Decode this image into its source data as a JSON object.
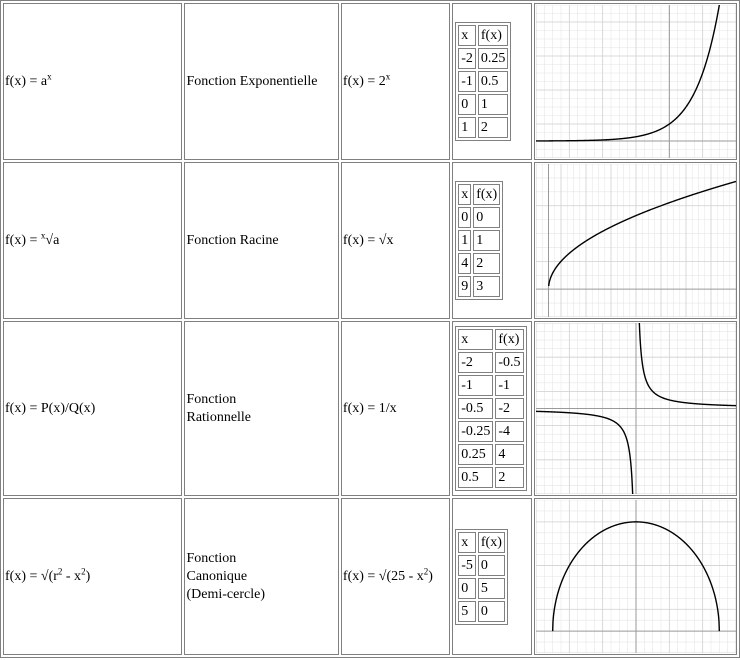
{
  "headings": {
    "row0_formula": "f(x) = a",
    "row0_formula_sup": "x",
    "row1_formula_pre": "f(x) = ",
    "row1_formula_sup": "x",
    "row1_formula_post": "√a",
    "row2_formula": "f(x) = P(x)/Q(x)",
    "row3_formula_pre": "f(x) = √(r",
    "row3_formula_sup1": "2",
    "row3_formula_mid": " - x",
    "row3_formula_sup2": "2",
    "row3_formula_post": ")"
  },
  "rows": [
    {
      "name": "Fonction Exponentielle",
      "example_pre": "f(x) = 2",
      "example_sup": "x",
      "table_header": [
        "x",
        "f(x)"
      ],
      "table_rows": [
        [
          "-2",
          "0.25"
        ],
        [
          "-1",
          "0.5"
        ],
        [
          "0",
          "1"
        ],
        [
          "1",
          "2"
        ]
      ]
    },
    {
      "name": "Fonction Racine",
      "example_pre": "f(x) = √x",
      "table_header": [
        "x",
        "f(x)"
      ],
      "table_rows": [
        [
          "0",
          "0"
        ],
        [
          "1",
          "1"
        ],
        [
          "4",
          "2"
        ],
        [
          "9",
          "3"
        ]
      ]
    },
    {
      "name_line1": "Fonction",
      "name_line2": "Rationnelle",
      "example_pre": "f(x) = 1/x",
      "table_header": [
        "x",
        "f(x)"
      ],
      "table_rows": [
        [
          "-2",
          "-0.5"
        ],
        [
          "-1",
          "-1"
        ],
        [
          "-0.5",
          "-2"
        ],
        [
          "-0.25",
          "-4"
        ],
        [
          "0.25",
          "4"
        ],
        [
          "0.5",
          "2"
        ]
      ]
    },
    {
      "name_line1": "Fonction",
      "name_line2": "Canonique",
      "name_line3": "(Demi-cercle)",
      "example_pre": "f(x) = √(25 - x",
      "example_sup": "2",
      "example_post": ")",
      "table_header": [
        "x",
        "f(x)"
      ],
      "table_rows": [
        [
          "-5",
          "0"
        ],
        [
          "0",
          "5"
        ],
        [
          "5",
          "0"
        ]
      ]
    }
  ],
  "chart_data": [
    {
      "type": "line",
      "function": "2^x",
      "xlim": [
        -8,
        4
      ],
      "ylim": [
        -1,
        8
      ],
      "grid": true,
      "title": "",
      "xlabel": "",
      "ylabel": ""
    },
    {
      "type": "line",
      "function": "sqrt(x)",
      "xlim": [
        -1,
        15
      ],
      "ylim": [
        -1,
        4.5
      ],
      "grid": true,
      "title": "",
      "xlabel": "",
      "ylabel": ""
    },
    {
      "type": "line",
      "function": "1/x",
      "xlim": [
        -6,
        6
      ],
      "ylim": [
        -5,
        5
      ],
      "grid": true,
      "title": "",
      "xlabel": "",
      "ylabel": ""
    },
    {
      "type": "line",
      "function": "sqrt(25 - x^2)",
      "xlim": [
        -6,
        6
      ],
      "ylim": [
        -1,
        6
      ],
      "grid": true,
      "title": "",
      "xlabel": "",
      "ylabel": ""
    }
  ],
  "style": {
    "border_color": "#808080",
    "curve_color": "#000000",
    "grid_color": "#e6e6e6",
    "axis_color": "#9a9a9a"
  }
}
